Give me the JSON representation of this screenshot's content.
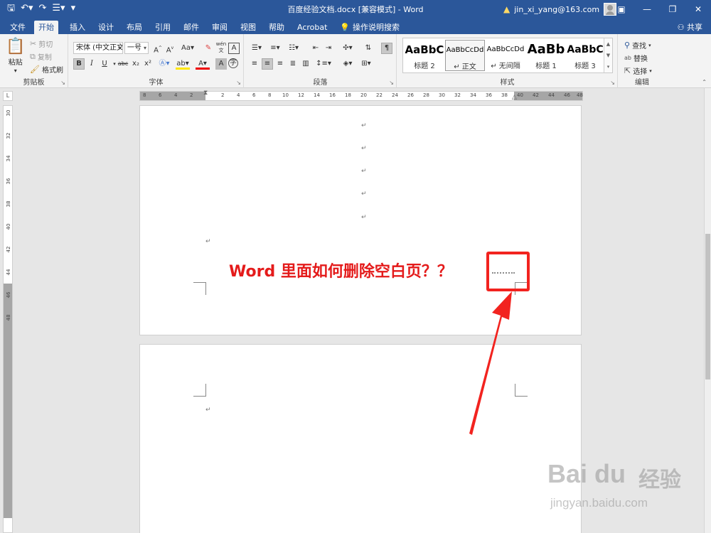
{
  "window": {
    "title": "百度经验文档.docx [兼容模式]  -  Word",
    "user": "jin_xi_yang@163.com"
  },
  "tabs": [
    "文件",
    "开始",
    "插入",
    "设计",
    "布局",
    "引用",
    "邮件",
    "审阅",
    "视图",
    "帮助",
    "Acrobat",
    "操作说明搜索"
  ],
  "share_label": "共享",
  "clipboard": {
    "paste": "粘贴",
    "cut": "剪切",
    "copy": "复制",
    "format_painter": "格式刷",
    "group_label": "剪贴板"
  },
  "font": {
    "name": "宋体 (中文正文)",
    "size": "一号",
    "group_label": "字体",
    "phonetic": "wén",
    "bold": "B",
    "italic": "I",
    "underline": "U",
    "strike": "abc",
    "subscript": "x₂",
    "superscript": "x²"
  },
  "paragraph": {
    "group_label": "段落"
  },
  "styles": {
    "group_label": "样式",
    "items": [
      {
        "sample": "AaBbC",
        "name": "标题 2"
      },
      {
        "sample": "AaBbCcDd",
        "name": "↵ 正文"
      },
      {
        "sample": "AaBbCcDd",
        "name": "↵ 无间隔"
      },
      {
        "sample": "AaBb",
        "name": "标题 1"
      },
      {
        "sample": "AaBbC",
        "name": "标题 3"
      }
    ]
  },
  "editing": {
    "find": "查找",
    "replace": "替换",
    "select": "选择",
    "group_label": "编辑"
  },
  "ruler": {
    "h_ticks": [
      "8",
      "6",
      "4",
      "2",
      "2",
      "4",
      "6",
      "8",
      "10",
      "12",
      "14",
      "16",
      "18",
      "20",
      "22",
      "24",
      "26",
      "28",
      "30",
      "32",
      "34",
      "36",
      "38",
      "40",
      "42",
      "44",
      "46",
      "48"
    ],
    "v_ticks": [
      "30",
      "32",
      "34",
      "36",
      "38",
      "40",
      "42",
      "44",
      "46",
      "48"
    ]
  },
  "document": {
    "headline": "Word 里面如何删除空白页？？",
    "para_mark": "↵"
  },
  "watermark": {
    "logo": "Bai du",
    "cn": "经验",
    "url": "jingyan.baidu.com"
  },
  "colors": {
    "ribbon_blue": "#2b579a",
    "annotation_red": "#f2231f"
  }
}
